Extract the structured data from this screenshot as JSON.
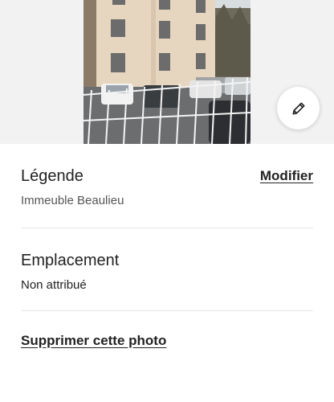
{
  "photo": {
    "description": "building-photo",
    "edit_icon": "pencil-icon"
  },
  "caption_section": {
    "title": "Légende",
    "value": "Immeuble Beaulieu",
    "action_label": "Modifier"
  },
  "location_section": {
    "title": "Emplacement",
    "value": "Non attribué"
  },
  "delete_label": "Supprimer cette photo",
  "colors": {
    "text": "#222222",
    "muted": "#555555",
    "divider": "#e6e6e6",
    "photo_bg": "#f2f2f2"
  }
}
